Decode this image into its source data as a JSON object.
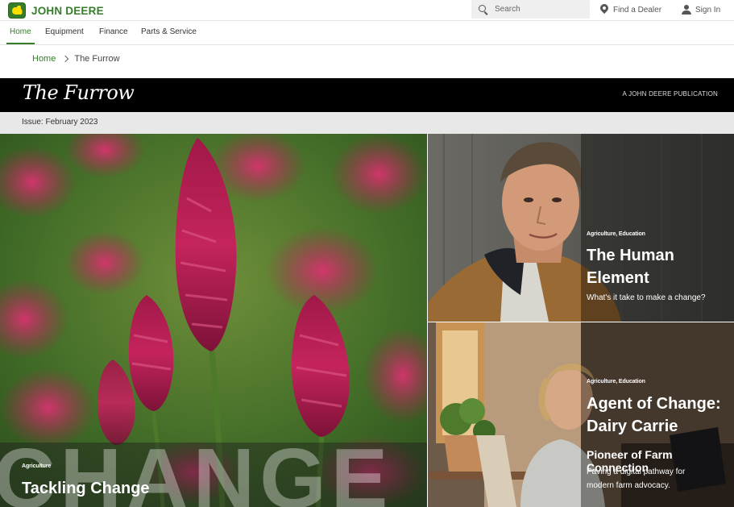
{
  "header": {
    "brand": "JOHN DEERE",
    "search_placeholder": "Search",
    "find_dealer": "Find a Dealer",
    "sign_in": "Sign In"
  },
  "nav": {
    "items": [
      {
        "label": "Home",
        "active": true
      },
      {
        "label": "Equipment",
        "active": false
      },
      {
        "label": "Finance",
        "active": false
      },
      {
        "label": "Parts & Service",
        "active": false
      }
    ]
  },
  "breadcrumb": {
    "home": "Home",
    "current": "The Furrow"
  },
  "furrow": {
    "logo": "The Furrow",
    "publication": "A JOHN DEERE PUBLICATION",
    "issue": "Issue: February 2023"
  },
  "tiles": {
    "left": {
      "background_word": "CHANGE",
      "category": "Agriculture",
      "title": "Tackling Change"
    },
    "right_top": {
      "category": "Agriculture, Education",
      "title_line1": "The Human",
      "title_line2": "Element",
      "description": "What's it take to make a change?"
    },
    "right_bottom": {
      "category": "Agriculture, Education",
      "title_line1": "Agent of Change:",
      "title_line2": "Dairy Carrie",
      "subtitle": "Pioneer of Farm Connection",
      "desc_line1": "Paving a digital pathway for",
      "desc_line2": "modern farm advocacy."
    }
  },
  "colors": {
    "brand_green": "#367c2b",
    "brand_yellow": "#ffde00",
    "banner_black": "#000000",
    "issue_bar": "#e8e8e8"
  }
}
